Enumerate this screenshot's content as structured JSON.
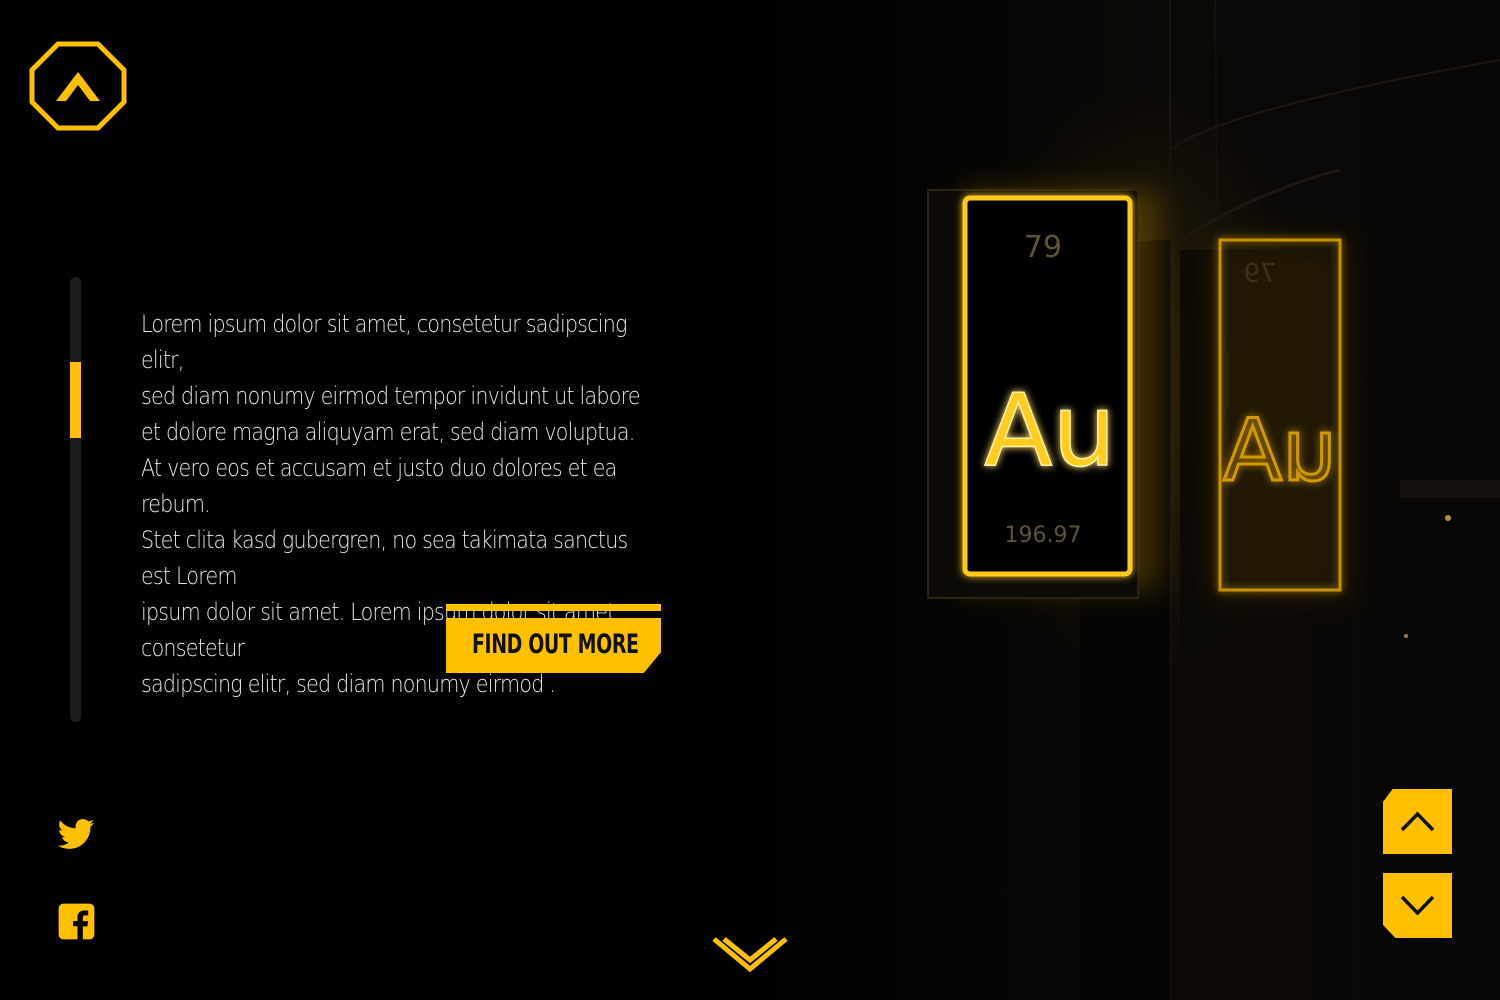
{
  "brand": {
    "logo_icon": "hexagon-chevron-logo",
    "accent_color": "#ffc000",
    "background_color": "#000000"
  },
  "intro": {
    "text": "Lorem ipsum dolor sit amet, consetetur sadipscing elitr,\nsed diam nonumy eirmod tempor invidunt ut labore\net dolore magna aliquyam erat, sed diam voluptua.\n At vero eos et accusam et justo duo dolores et ea rebum.\nStet clita kasd gubergren, no sea takimata sanctus est Lorem\nipsum dolor sit amet. Lorem ipsum dolor sit amet, consetetur\nsadipscing elitr, sed diam nonumy eirmod ."
  },
  "cta": {
    "label": "FIND OUT MORE"
  },
  "progress": {
    "position_fraction": 0.19,
    "visible_fraction": 0.17
  },
  "social": {
    "items": [
      {
        "name": "twitter",
        "icon": "twitter-icon"
      },
      {
        "name": "facebook",
        "icon": "facebook-icon"
      }
    ]
  },
  "navigation": {
    "up_icon": "chevron-up-icon",
    "down_icon": "chevron-down-icon",
    "scroll_icon": "double-chevron-down-icon"
  },
  "hero": {
    "sign_number": "79",
    "sign_symbol": "Au",
    "sign_mass": "196.97",
    "reflection_number": "79",
    "reflection_symbol": "uA"
  }
}
